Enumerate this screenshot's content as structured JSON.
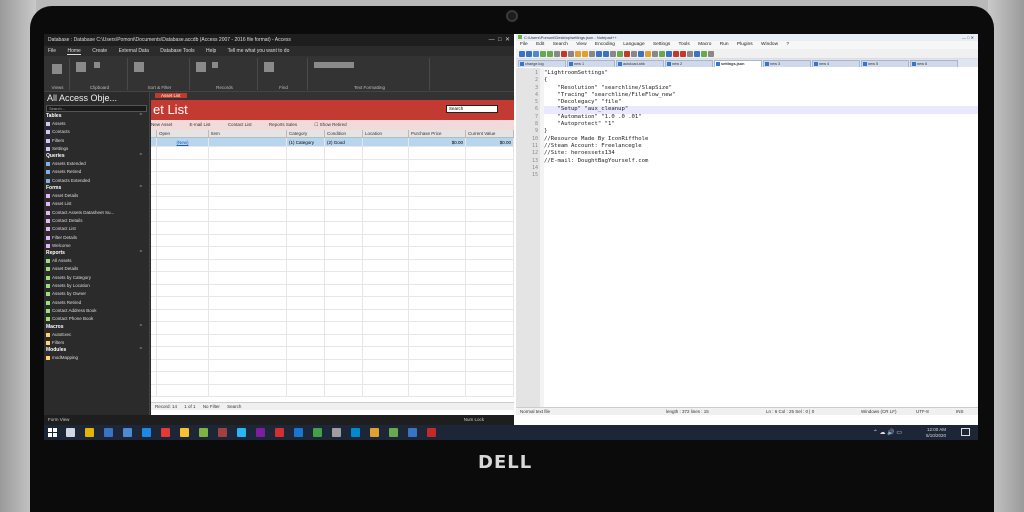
{
  "device": {
    "brand": "DELL"
  },
  "access": {
    "title": "Database : Database C:\\Users\\Pomoni\\Documents\\Database.accdb (Access 2007 - 2016 file format) - Access",
    "tabs": [
      "File",
      "Home",
      "Create",
      "External Data",
      "Database Tools",
      "Help",
      "Tell me what you want to do"
    ],
    "ribbon_groups": [
      "Views",
      "Clipboard",
      "Sort & Filter",
      "Records",
      "Find",
      "Text Formatting"
    ],
    "nav_title": "All Access Obje...",
    "nav_search": "Search...",
    "sections": [
      {
        "name": "Tables",
        "kind": "t",
        "items": [
          "Assets",
          "Contacts",
          "Filters",
          "Settings"
        ]
      },
      {
        "name": "Queries",
        "kind": "q",
        "items": [
          "Assets Extended",
          "Assets Retired",
          "Contacts Extended"
        ]
      },
      {
        "name": "Forms",
        "kind": "f",
        "items": [
          "Asset Details",
          "Asset List",
          "Contact Assets Datasheet Su...",
          "Contact Details",
          "Contact List",
          "Filter Details",
          "Welcome"
        ]
      },
      {
        "name": "Reports",
        "kind": "r",
        "items": [
          "All Assets",
          "Asset Details",
          "Assets by Category",
          "Assets by Location",
          "Assets by Owner",
          "Assets Retired",
          "Contact Address Book",
          "Contact Phone Book"
        ]
      },
      {
        "name": "Macros",
        "kind": "m",
        "items": [
          "AutoExec",
          "Filters"
        ]
      },
      {
        "name": "Modules",
        "kind": "m",
        "items": [
          "modMapping"
        ]
      }
    ],
    "doc_tab": "Asset List",
    "form_title": "et List",
    "form_search": "Search",
    "toolbar": [
      "New Asset",
      "E-mail List",
      "Contact List",
      "Reports Sales",
      "Show Retired"
    ],
    "columns": [
      "",
      "Open",
      "Item",
      "Category",
      "Condition",
      "Location",
      "Purchase Price",
      "Current Value"
    ],
    "row": {
      "open": "(New)",
      "item": "",
      "category": "(1) Category",
      "condition": "(2) Good",
      "location": "",
      "purchase_price": "$0.00",
      "current_value": "$0.00"
    },
    "record_nav": [
      "Record: 14",
      "1 of 1",
      "No Filter",
      "Search"
    ],
    "status_left": "Form View",
    "status_right": "Num Lock"
  },
  "notepad": {
    "title": "C:\\Users\\Pomoni\\Desktop\\settings.json - Notepad++",
    "menu": [
      "File",
      "Edit",
      "Search",
      "View",
      "Encoding",
      "Language",
      "Settings",
      "Tools",
      "Macro",
      "Run",
      "Plugins",
      "Window",
      "?"
    ],
    "tabs": [
      "change.log",
      "new 1",
      "autoload.ahk",
      "new 2",
      "settings.json",
      "new 3",
      "new 4",
      "new 5",
      "new 6"
    ],
    "lines": [
      "\"LightroomSettings\"",
      "{",
      "    \"Resolution\" \"searchline/SlapSize\"",
      "    \"Tracing\" \"searchline/FileFlow_new\"",
      "    \"Decolegacy\" \"file\"",
      "    \"Setup\" \"aux_cleanup\"",
      "    \"Automation\" \"1.0 .0 .01\"",
      "    \"Autoprotect\" \"1\"",
      "}",
      "//Resource Made By IconRiffhole",
      "//Steam Account: Freelancegle",
      "//Site: heroessets134",
      "//E-mail: DoughtBagYourself.com",
      "",
      ""
    ],
    "status": [
      "Normal text file",
      "length : 372   lines : 15",
      "Ln : 6   Col : 25   Sel : 0 | 0",
      "Windows (CR LF)",
      "UTF-8",
      "INS"
    ]
  },
  "taskbar": {
    "time": "12:00 AM",
    "date": "5/10/2020"
  }
}
